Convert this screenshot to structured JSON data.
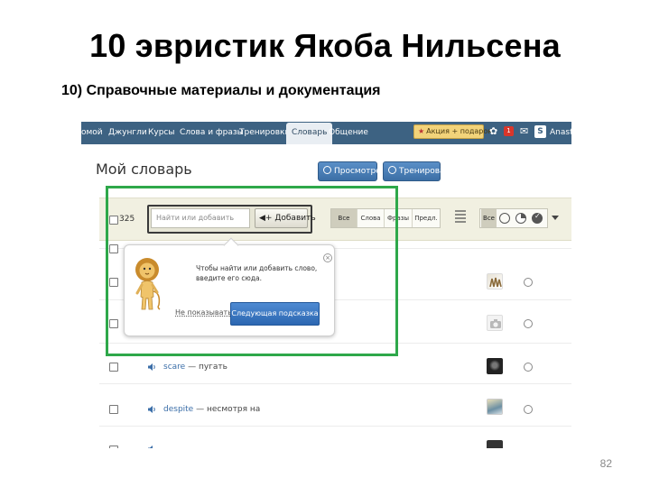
{
  "slide": {
    "title": "10 эвристик Якоба Нильсена",
    "subtitle": "10) Справочные материалы и документация",
    "page_number": "82"
  },
  "nav": {
    "items": [
      "омой",
      "Джунгли",
      "Курсы",
      "Слова и фразы",
      "Тренировки",
      "Словарь",
      "Общение"
    ],
    "active": "Словарь",
    "promo": "Акция + подарок",
    "notification_count": "1",
    "user_name": "Anastas"
  },
  "dictionary": {
    "title": "Мой словарь",
    "view_button": "Просмотреть",
    "train_button": "Тренировать",
    "word_count": "325",
    "search_placeholder": "Найти или добавить",
    "add_button": "Добавить",
    "filters": [
      "Все",
      "Слова",
      "Фразы",
      "Предл."
    ],
    "active_filter": "Все",
    "status_all": "Все"
  },
  "tooltip": {
    "text": "Чтобы найти или добавить слово, введите его сюда.",
    "dismiss": "Не показывать",
    "next": "Следующая подсказка"
  },
  "words": [
    {
      "word": "scare",
      "dash": "—",
      "translation": "пугать"
    },
    {
      "word": "despite",
      "dash": "—",
      "translation": "несмотря на"
    }
  ],
  "colors": {
    "nav_bg": "#3d6282",
    "highlight": "#2ea84a",
    "accent_blue": "#2c67b1"
  }
}
